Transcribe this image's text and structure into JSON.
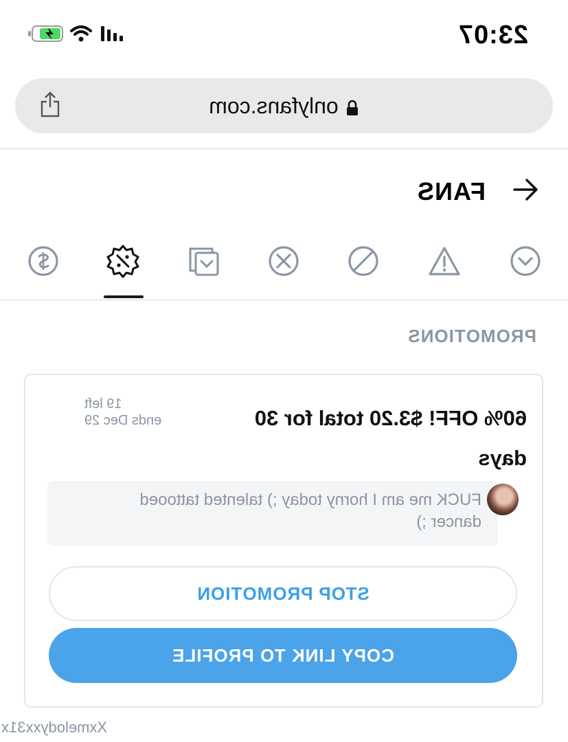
{
  "status_bar": {
    "time": "23:07"
  },
  "browser": {
    "url": "onlyfans.com"
  },
  "header": {
    "title": "FANS"
  },
  "tabs": [
    {
      "icon": "chevron-down-circle-icon"
    },
    {
      "icon": "warning-icon"
    },
    {
      "icon": "blocked-icon"
    },
    {
      "icon": "close-circle-icon"
    },
    {
      "icon": "collections-icon"
    },
    {
      "icon": "promotion-badge-icon",
      "active": true
    },
    {
      "icon": "dollar-circle-icon"
    }
  ],
  "section": {
    "title": "PROMOTIONS"
  },
  "promotion": {
    "headline": "60% OFF! $3.20 total for 30 days",
    "left": "19 left",
    "ends": "ends Dec 29",
    "message": "FUCK me am I horny today ;) talented tattooed dancer ;)",
    "stop_label": "STOP PROMOTION",
    "copy_label": "COPY LINK TO PROFILE"
  },
  "footer": {
    "username": "Xxmelodyxx31x"
  },
  "colors": {
    "accent": "#4ba3ea",
    "muted": "#8a96a3"
  }
}
